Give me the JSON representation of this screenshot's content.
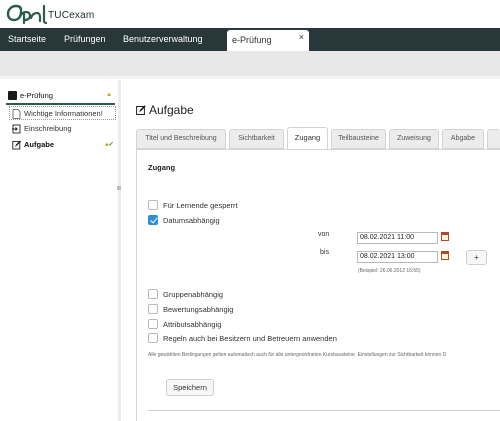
{
  "brand": {
    "name": "TUCexam"
  },
  "nav": {
    "items": [
      {
        "label": "Startseite"
      },
      {
        "label": "Prüfungen"
      },
      {
        "label": "Benutzerverwaltung"
      }
    ],
    "open_tab": {
      "label": "e-Prüfung",
      "close": "×"
    }
  },
  "menu": {
    "root": {
      "label": "e-Prüfung"
    },
    "items": [
      {
        "label": "Wichtige Informationen!"
      },
      {
        "label": "Einschreibung"
      },
      {
        "label": "Aufgabe"
      }
    ]
  },
  "page": {
    "title": "Aufgabe"
  },
  "tabs": [
    {
      "label": "Titel und Beschreibung"
    },
    {
      "label": "Sichtbarkeit"
    },
    {
      "label": "Zugang"
    },
    {
      "label": "Teilbausteine"
    },
    {
      "label": "Zuweisung"
    },
    {
      "label": "Abgabe"
    }
  ],
  "access": {
    "heading": "Zugang",
    "blocked": {
      "label": "Für Lernende gesperrt",
      "checked": false
    },
    "date_dependent": {
      "label": "Datumsabhängig",
      "checked": true
    },
    "from_label": "von",
    "from_value": "08.02.2021 11:00",
    "to_label": "bis",
    "to_value": "08.02.2021 13:00",
    "example": "(Beispiel: 26.06.2012 16:55)",
    "add_label": "+",
    "group": {
      "label": "Gruppenabhängig",
      "checked": false
    },
    "assessment": {
      "label": "Bewertungsabhängig",
      "checked": false
    },
    "attribute": {
      "label": "Attributsabhängig",
      "checked": false
    },
    "owners": {
      "label": "Regeln auch bei Besitzern und Betreuern anwenden",
      "checked": false
    },
    "note": "Alle gewählten Bedingungen gelten automatisch auch für alle untergeordneten Kursbausteine. Einstellungen zur Sichtbarkeit können D",
    "save_label": "Speichern"
  },
  "colors": {
    "nav_bg": "#27373a",
    "accent_green": "#2a5b4d",
    "checkbox_on": "#2f8fd6"
  }
}
